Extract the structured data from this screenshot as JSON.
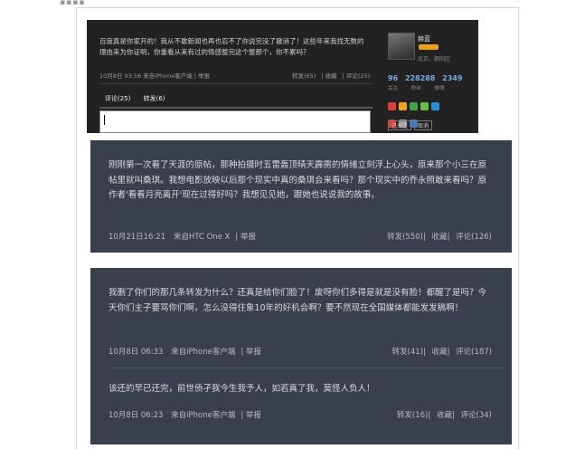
{
  "top_screenshot": {
    "text": "百度真是你家开的！我从不敢新闻也再也忍不了你说完没了撤消了！这些年来我找无数的理由来为你证明，你重看从来有过的情感整完这个整那个，你不累吗？",
    "meta": "10月8日 03:56 来自iPhone客户端 | 举报",
    "actions": [
      "转发(65)",
      "收藏",
      "评论(25)"
    ],
    "tabs": [
      "评论(25)",
      "转发(6)"
    ],
    "profile": {
      "name": "赫蓝",
      "location": "北京，朝阳区",
      "stats": [
        "96",
        "228288",
        "2349"
      ],
      "stat_labels": [
        "关注",
        "粉丝",
        "微博"
      ],
      "follow_buttons": [
        "已关注",
        "取消"
      ]
    },
    "colors": {
      "icons": [
        "#d9413a",
        "#f0a21f",
        "#3fa14b",
        "#6bbd45",
        "#2c8fd6",
        "#d9413a",
        "#9c9c9c",
        "#3a7ac8"
      ]
    }
  },
  "posts": [
    {
      "text": "刚刚第一次看了天涯的原帖，那种拍摄时五雷轰顶晴天霹雳的情绪立刻浮上心头，原来那个小三在原帖里就叫桑琪。我想电影放映以后那个现实中真的桑琪会来看吗？那个现实中的乔永照敢来看吗？原作者'看看月亮离开'现在过得好吗？我想见见她，跟她也说说我的故事。",
      "meta": [
        "10月21日16:21",
        "来自HTC One X",
        "举报"
      ],
      "actions": [
        "转发(550)",
        "收藏",
        "评论(126)"
      ]
    },
    {
      "text": "我删了你们的那几条转发为什么？还真是给你们脸了！废呀你们多得是就是没有脸！都醒了是吗？今天你们主子要骂你们啊，怎么没得住象10年的好机会啊？要不然现在全国媒体都能发发稿啊！",
      "meta": [
        "10月8日 06:33",
        "来自iPhone客户端",
        "举报"
      ],
      "actions": [
        "转发(41)",
        "收藏",
        "评论(187)"
      ]
    },
    {
      "text": "该还的早已还完，前世债孑我今生我予人，如若真了我，莫怪人负人！",
      "meta": [
        "10月8日 06:23",
        "来自iPhone客户端",
        "举报"
      ],
      "actions": [
        "转发(16)",
        "收藏",
        "评论(34)"
      ]
    }
  ]
}
